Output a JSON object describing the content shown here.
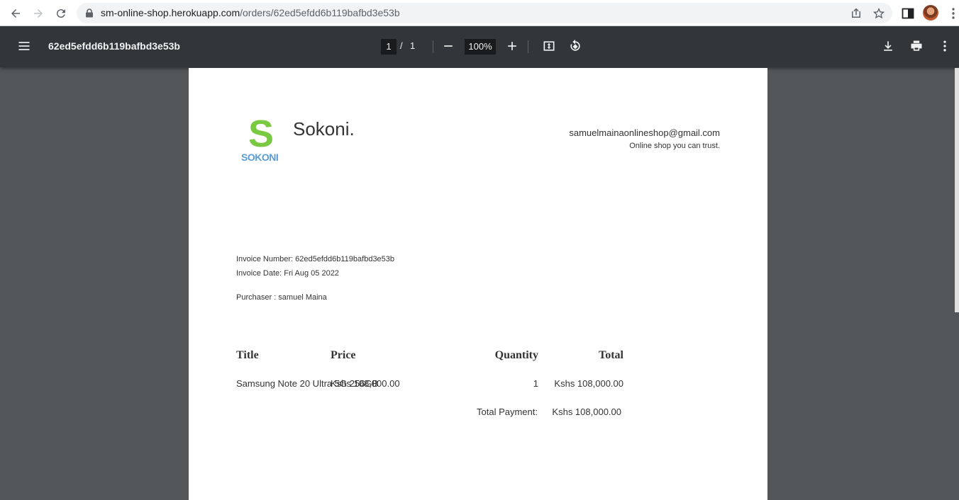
{
  "browser": {
    "url_host": "sm-online-shop.herokuapp.com",
    "url_path": "/orders/62ed5efdd6b119bafbd3e53b"
  },
  "pdf_toolbar": {
    "title": "62ed5efdd6b119bafbd3e53b",
    "current_page": "1",
    "page_separator": "/",
    "total_pages": "1",
    "zoom": "100%"
  },
  "invoice": {
    "logo_letter": "S",
    "logo_text": "SOKONI",
    "brand": "Sokoni.",
    "email": "samuelmainaonlineshop@gmail.com",
    "tagline": "Online shop you can trust.",
    "invoice_number": "Invoice Number: 62ed5efdd6b119bafbd3e53b",
    "invoice_date": "Invoice Date: Fri Aug 05 2022",
    "purchaser": "Purchaser : samuel Maina",
    "headers": {
      "title": "Title",
      "price": "Price",
      "quantity": "Quantity",
      "total": "Total"
    },
    "items": [
      {
        "title": "Samsung Note 20 Ultra 5G 256GB",
        "price": "Kshs 108,000.00",
        "quantity": "1",
        "total": "Kshs 108,000.00"
      }
    ],
    "total_payment_label": "Total Payment:",
    "total_payment_value": "Kshs 108,000.00"
  }
}
